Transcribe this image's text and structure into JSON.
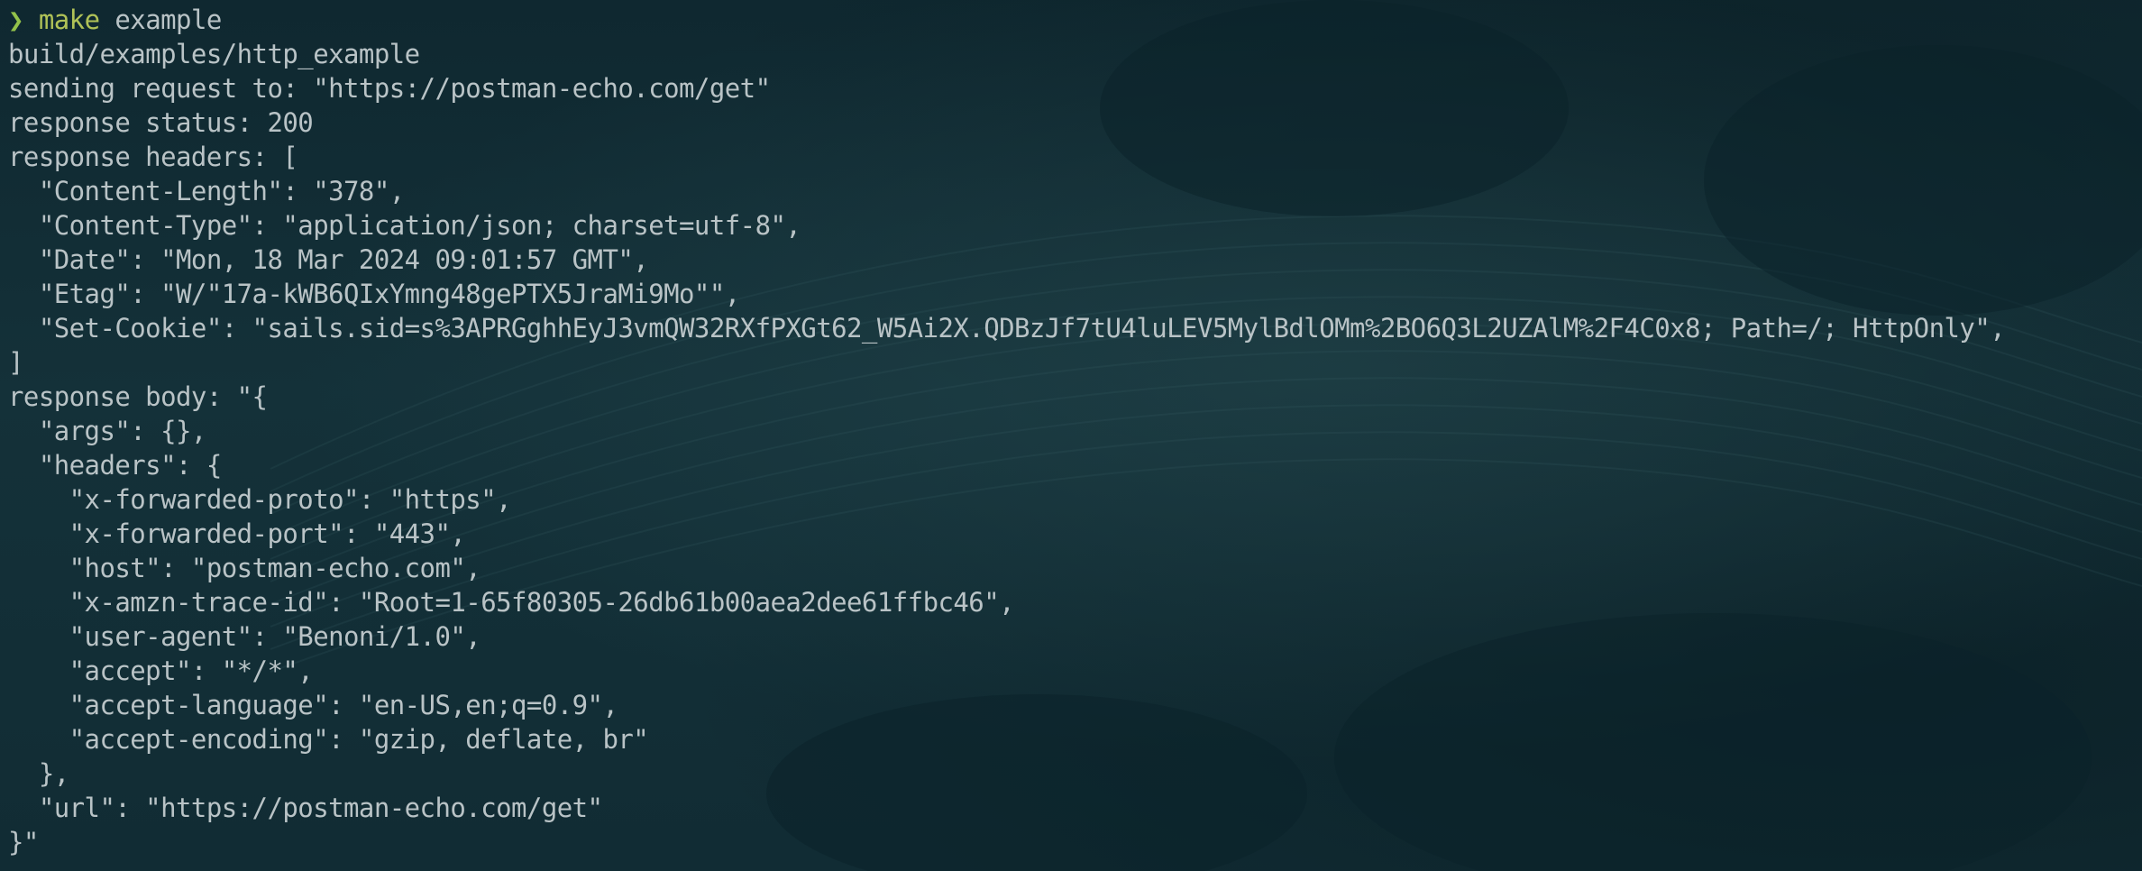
{
  "terminal": {
    "prompt": {
      "symbol": "❯",
      "command": "make",
      "argument": " example"
    },
    "output_lines": [
      "build/examples/http_example",
      "sending request to: \"https://postman-echo.com/get\"",
      "response status: 200",
      "response headers: [",
      "  \"Content-Length\": \"378\",",
      "  \"Content-Type\": \"application/json; charset=utf-8\",",
      "  \"Date\": \"Mon, 18 Mar 2024 09:01:57 GMT\",",
      "  \"Etag\": \"W/\"17a-kWB6QIxYmng48gePTX5JraMi9Mo\"\",",
      "  \"Set-Cookie\": \"sails.sid=s%3APRGghhEyJ3vmQW32RXfPXGt62_W5Ai2X.QDBzJf7tU4luLEV5MylBdlOMm%2BO6Q3L2UZAlM%2F4C0x8; Path=/; HttpOnly\",",
      "]",
      "response body: \"{",
      "  \"args\": {},",
      "  \"headers\": {",
      "    \"x-forwarded-proto\": \"https\",",
      "    \"x-forwarded-port\": \"443\",",
      "    \"host\": \"postman-echo.com\",",
      "    \"x-amzn-trace-id\": \"Root=1-65f80305-26db61b00aea2dee61ffbc46\",",
      "    \"user-agent\": \"Benoni/1.0\",",
      "    \"accept\": \"*/*\",",
      "    \"accept-language\": \"en-US,en;q=0.9\",",
      "    \"accept-encoding\": \"gzip, deflate, br\"",
      "  },",
      "  \"url\": \"https://postman-echo.com/get\"",
      "}\""
    ]
  },
  "colors": {
    "background": "#102a33",
    "text": "#b9c3c6",
    "prompt_symbol": "#93c24a",
    "command": "#b0c257"
  }
}
